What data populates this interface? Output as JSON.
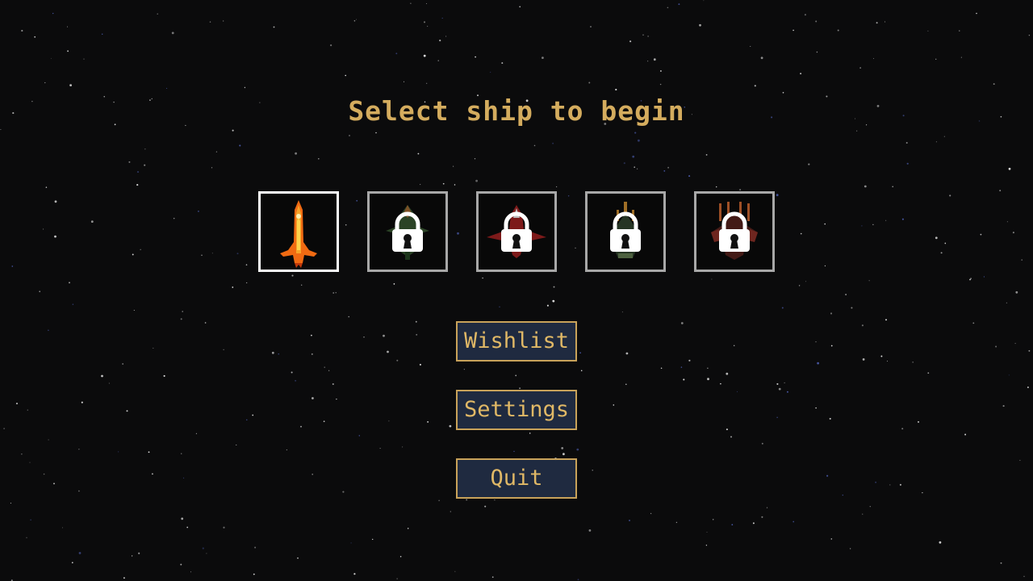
{
  "title": "Select ship to begin",
  "colors": {
    "background": "#0b0b0c",
    "title": "#d4ac5e",
    "button_text": "#e0b866",
    "button_border": "#c8a25a",
    "button_fill": "#1f2a40",
    "slot_border": "#a8a8a8",
    "slot_border_selected": "#ffffff"
  },
  "ships": [
    {
      "id": "ship-1",
      "state": "unlocked",
      "selected": true,
      "icon": "orange-rocket-icon"
    },
    {
      "id": "ship-2",
      "state": "locked",
      "selected": false,
      "icon": "padlock-icon"
    },
    {
      "id": "ship-3",
      "state": "locked",
      "selected": false,
      "icon": "padlock-icon"
    },
    {
      "id": "ship-4",
      "state": "locked",
      "selected": false,
      "icon": "padlock-icon"
    },
    {
      "id": "ship-5",
      "state": "locked",
      "selected": false,
      "icon": "padlock-icon"
    }
  ],
  "menu": {
    "wishlist_label": "Wishlist",
    "settings_label": "Settings",
    "quit_label": "Quit"
  }
}
